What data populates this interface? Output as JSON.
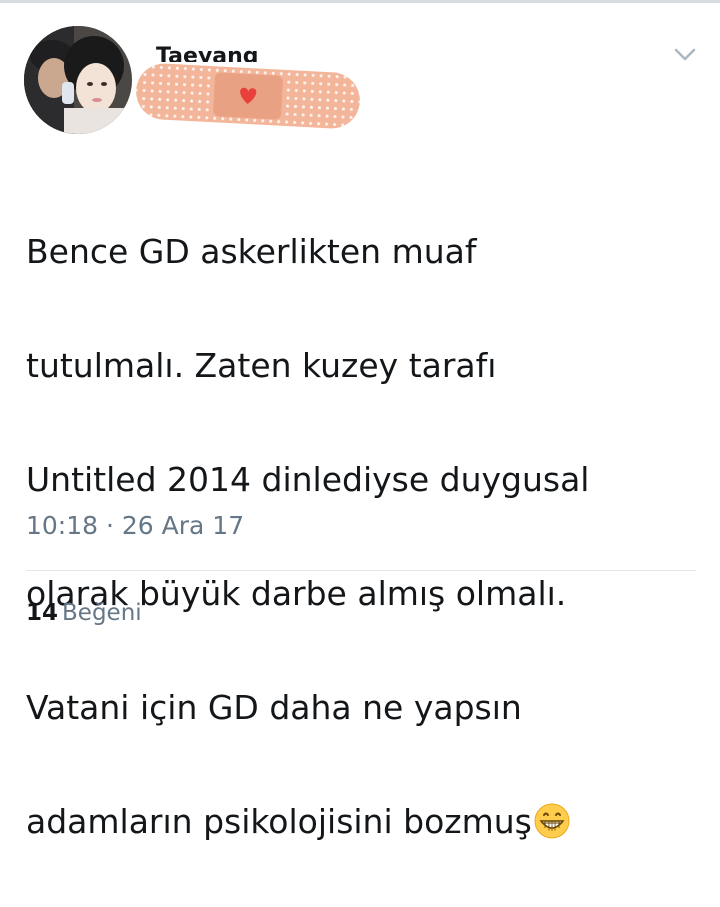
{
  "tweet": {
    "display_name": "Taeyang",
    "text_lines": [
      "Bence GD askerlikten muaf",
      "tutulmalı. Zaten kuzey tarafı",
      "Untitled 2014 dinlediyse duygusal",
      "olarak büyük darbe almış olmalı.",
      "Vatani için GD daha ne yapsın",
      "adamların psikolojisini bozmuş"
    ],
    "emoji": "grinning-face-emoji",
    "time": "10:18",
    "separator": "·",
    "date": "26 Ara 17",
    "like_count": "14",
    "like_label": "Beğeni"
  },
  "icons": {
    "more_menu": "chevron-down-icon",
    "name_cover": "bandage-sticker"
  },
  "colors": {
    "text": "#14171a",
    "secondary_text": "#657786",
    "divider": "#e1e8ed",
    "bandage": "#f4b69a",
    "heart": "#e8413c"
  }
}
